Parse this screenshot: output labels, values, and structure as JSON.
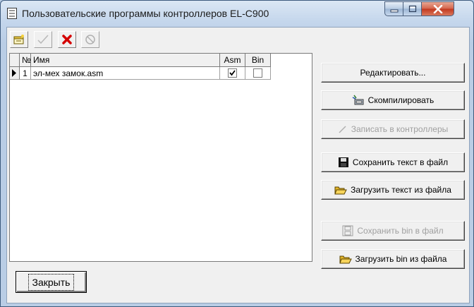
{
  "window": {
    "title": "Пользовательские программы контроллеров EL-C900",
    "title_icon": "program-list-icon"
  },
  "caption_buttons": {
    "minimize": "minimize-icon",
    "maximize": "maximize-icon",
    "close": "close-icon"
  },
  "toolbar": [
    {
      "name": "new-program",
      "icon": "new-program-icon",
      "enabled": true
    },
    {
      "name": "confirm",
      "icon": "checkmark-icon",
      "enabled": false
    },
    {
      "name": "delete",
      "icon": "delete-x-icon",
      "enabled": true
    },
    {
      "name": "cancel",
      "icon": "cancel-circle-icon",
      "enabled": false
    }
  ],
  "grid": {
    "columns": [
      "№",
      "Имя",
      "Asm",
      "Bin"
    ],
    "rows": [
      {
        "num": "1",
        "name": "эл-мех замок.asm",
        "asm": true,
        "bin": false
      }
    ]
  },
  "buttons": {
    "edit": "Редактировать...",
    "compile": "Скомпилировать",
    "write": "Записать в контроллеры",
    "save_text": "Сохранить текст в файл",
    "load_text": "Загрузить текст из файла",
    "save_bin": "Сохранить bin в файл",
    "load_bin": "Загрузить bin из файла",
    "close": "Закрыть"
  },
  "colors": {
    "delete_red": "#d40000",
    "close_red": "#c2371e",
    "disabled_gray": "#a0a0a0"
  }
}
